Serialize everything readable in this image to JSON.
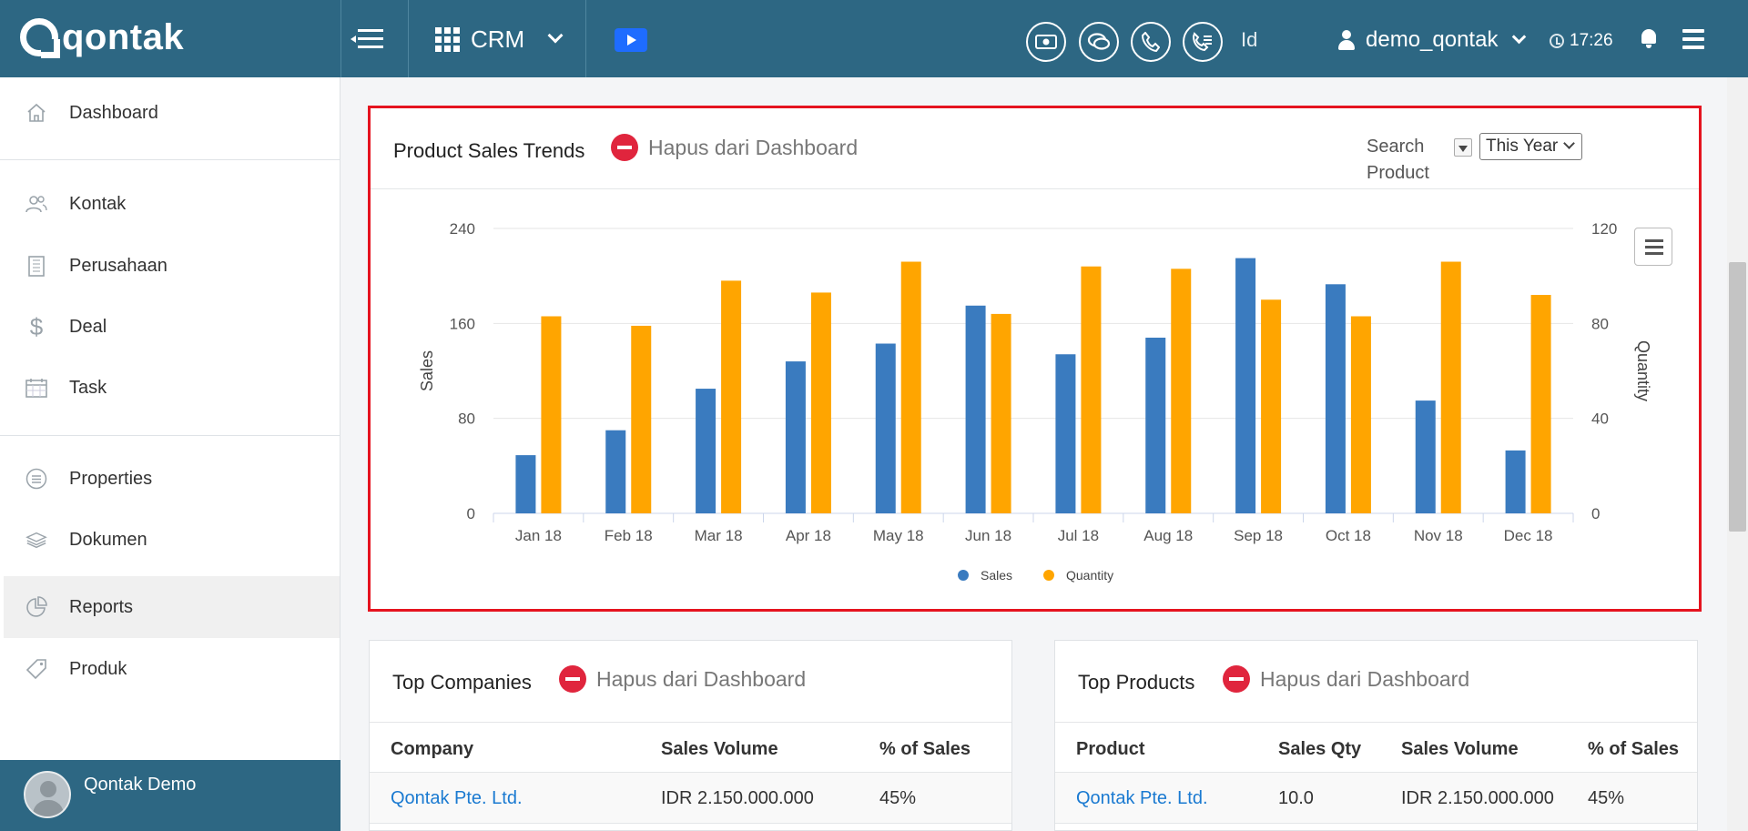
{
  "app": {
    "logo_text": "qontak",
    "module": "CRM",
    "language": "Id",
    "username": "demo_qontak",
    "time": "17:26"
  },
  "sidebar": {
    "items": [
      {
        "label": "Dashboard",
        "icon": "home-icon"
      },
      {
        "label": "Kontak",
        "icon": "contacts-icon"
      },
      {
        "label": "Perusahaan",
        "icon": "building-icon"
      },
      {
        "label": "Deal",
        "icon": "dollar-icon"
      },
      {
        "label": "Task",
        "icon": "calendar-icon"
      },
      {
        "label": "Properties",
        "icon": "list-circle-icon"
      },
      {
        "label": "Dokumen",
        "icon": "layers-icon"
      },
      {
        "label": "Reports",
        "icon": "pie-chart-icon"
      },
      {
        "label": "Produk",
        "icon": "tag-icon"
      }
    ],
    "active": "Reports",
    "footer_name": "Qontak Demo"
  },
  "chart_panel": {
    "title": "Product Sales Trends",
    "remove_label": "Hapus dari Dashboard",
    "search_label": "Search Product",
    "period": "This Year"
  },
  "chart_data": {
    "type": "bar",
    "categories": [
      "Jan 18",
      "Feb 18",
      "Mar 18",
      "Apr 18",
      "May 18",
      "Jun 18",
      "Jul 18",
      "Aug 18",
      "Sep 18",
      "Oct 18",
      "Nov 18",
      "Dec 18"
    ],
    "series": [
      {
        "name": "Sales",
        "axis": "left",
        "color": "#3a7bbf",
        "values": [
          49,
          70,
          105,
          128,
          143,
          175,
          134,
          148,
          215,
          193,
          95,
          53
        ]
      },
      {
        "name": "Quantity",
        "axis": "right",
        "color": "#ffa500",
        "values": [
          83,
          79,
          98,
          93,
          106,
          84,
          104,
          103,
          90,
          83,
          106,
          92
        ]
      }
    ],
    "ylabel": "Sales",
    "y2label": "Quantity",
    "ylim": [
      0,
      240
    ],
    "y2lim": [
      0,
      120
    ],
    "yticks": [
      0,
      80,
      160,
      240
    ],
    "y2ticks": [
      0,
      40,
      80,
      120
    ],
    "grid": true,
    "legend": "bottom-center"
  },
  "top_companies": {
    "title": "Top Companies",
    "remove_label": "Hapus dari Dashboard",
    "columns": [
      "Company",
      "Sales Volume",
      "% of Sales"
    ],
    "rows": [
      [
        "Qontak Pte. Ltd.",
        "IDR 2.150.000.000",
        "45%"
      ]
    ]
  },
  "top_products": {
    "title": "Top Products",
    "remove_label": "Hapus dari Dashboard",
    "columns": [
      "Product",
      "Sales Qty",
      "Sales Volume",
      "% of Sales"
    ],
    "rows": [
      [
        "Qontak Pte. Ltd.",
        "10.0",
        "IDR 2.150.000.000",
        "45%"
      ]
    ]
  }
}
